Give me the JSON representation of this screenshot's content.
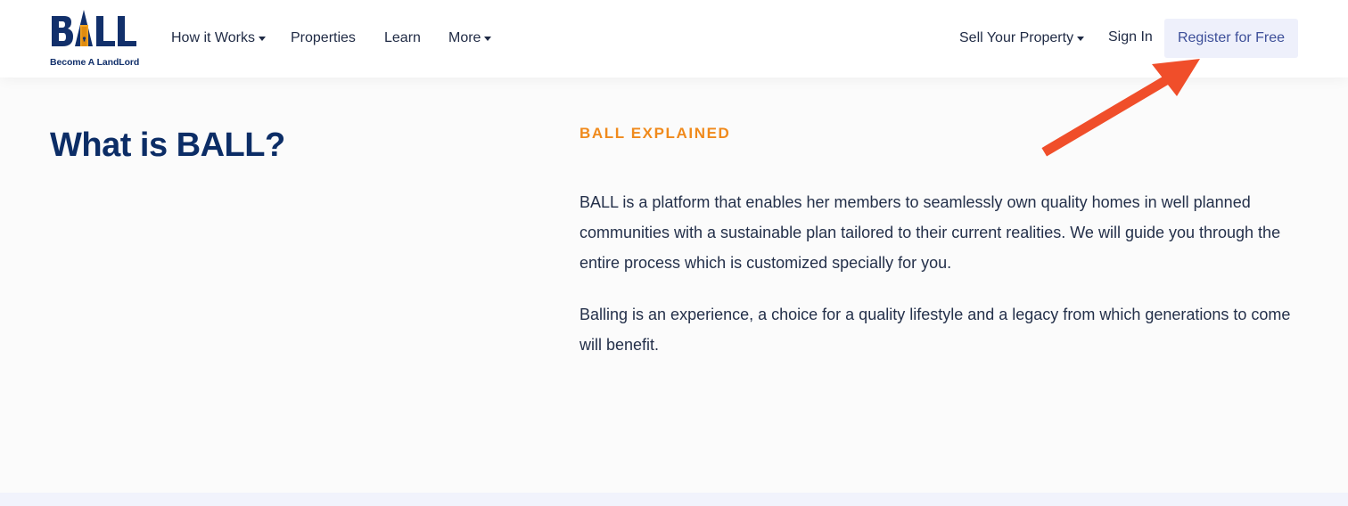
{
  "brand": {
    "logo_text": "BALL",
    "tagline": "Become A LandLord",
    "colors": {
      "navy": "#12306b",
      "orange": "#f5a623"
    }
  },
  "nav": {
    "how_it_works": "How it Works",
    "properties": "Properties",
    "learn": "Learn",
    "more": "More",
    "sell_property": "Sell Your Property",
    "sign_in": "Sign In",
    "register": "Register for Free"
  },
  "annotation": {
    "arrow_color": "#f04e2a",
    "icon": "arrow-up-right-icon"
  },
  "main": {
    "title": "What is BALL?",
    "eyebrow": "BALL EXPLAINED",
    "paragraphs": [
      "BALL is a platform that enables her members to seamlessly own quality homes in well planned communities with a sustainable plan tailored to their current realities. We will guide you through the entire process which is customized specially for you.",
      "Balling is an experience, a choice for a quality lifestyle and a legacy from which generations to come will benefit."
    ]
  },
  "colors": {
    "title": "#0c2d66",
    "eyebrow": "#f08a1c",
    "button_bg": "#eef0fb",
    "button_text": "#3d4f99"
  }
}
